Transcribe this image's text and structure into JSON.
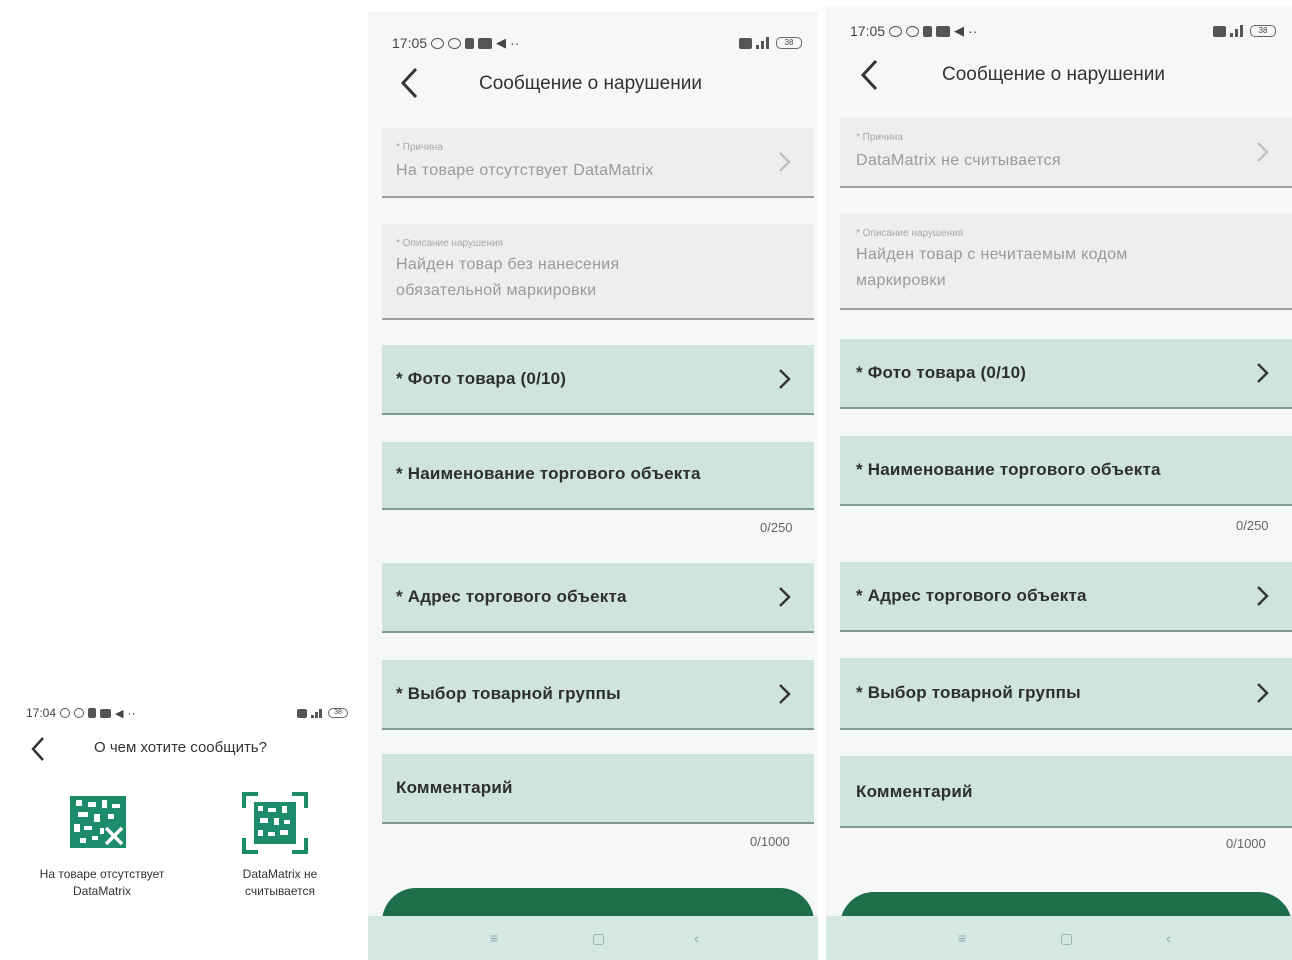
{
  "screen_a": {
    "status_time": "17:04",
    "battery": "38",
    "title": "О чем хотите сообщить?",
    "option_1": "На товаре отсутствует DataMatrix",
    "option_2": "DataMatrix не считывается"
  },
  "screen_b": {
    "status_time": "17:05",
    "battery": "38",
    "title": "Сообщение о нарушении",
    "reason_label": "* Причина",
    "reason_value": "На товаре отсутствует DataMatrix",
    "desc_label": "* Описание нарушения",
    "desc_value": "Найден товар без нанесения обязательной маркировки",
    "photo": "* Фото товара (0/10)",
    "store_name": "* Наименование торгового объекта",
    "store_name_counter": "0/250",
    "address": "* Адрес торгового объекта",
    "group": "* Выбор товарной группы",
    "comment": "Комментарий",
    "comment_counter": "0/1000"
  },
  "screen_c": {
    "status_time": "17:05",
    "battery": "38",
    "title": "Сообщение о нарушении",
    "reason_label": "* Причина",
    "reason_value": "DataMatrix не считывается",
    "desc_label": "* Описание нарушения",
    "desc_value": "Найден товар с нечитаемым кодом маркировки",
    "photo": "* Фото товара (0/10)",
    "store_name": "* Наименование торгового объекта",
    "store_name_counter": "0/250",
    "address": "* Адрес торгового объекта",
    "group": "* Выбор товарной группы",
    "comment": "Комментарий",
    "comment_counter": "0/1000"
  },
  "colors": {
    "field_green": "#cfe4dc",
    "field_grey": "#eeeeee",
    "cta_green": "#1e6e4c",
    "icon_teal": "#1d8c6a"
  },
  "icons": [
    "back-chevron-icon",
    "chevron-right-icon",
    "datamatrix-icon",
    "datamatrix-scan-icon",
    "menu-icon",
    "home-icon",
    "back-nav-icon"
  ]
}
